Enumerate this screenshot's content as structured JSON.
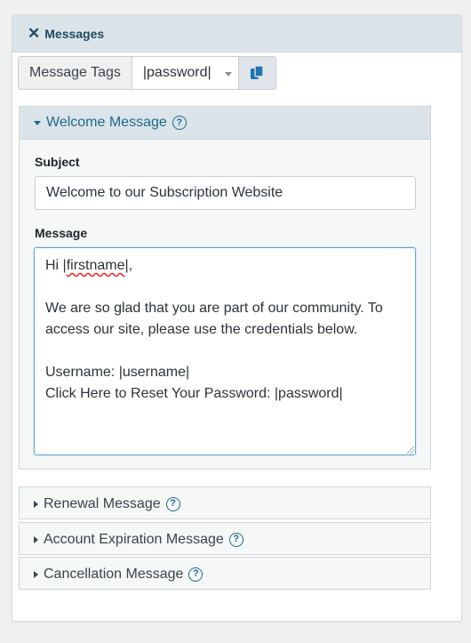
{
  "panel": {
    "close_glyph": "✕",
    "title": "Messages"
  },
  "tags": {
    "label": "Message Tags",
    "selected": "|password|",
    "copy_icon": "copy-icon"
  },
  "welcome": {
    "title": "Welcome Message",
    "help": "?",
    "subject_label": "Subject",
    "subject_value": "Welcome to our Subscription Website",
    "message_label": "Message",
    "message_line1_prefix": "Hi |",
    "message_line1_word": "firstname",
    "message_line1_suffix": "|,",
    "message_body": "We are so glad that you are part of our community. To access our site, please use the credentials below.",
    "message_username": "Username: |username|",
    "message_reset": "Click Here to Reset Your Password: |password|"
  },
  "collapsed_sections": [
    {
      "title": "Renewal Message",
      "help": "?"
    },
    {
      "title": "Account Expiration Message",
      "help": "?"
    },
    {
      "title": "Cancellation Message",
      "help": "?"
    }
  ],
  "colors": {
    "header_bg": "#dbe4e9",
    "accent": "#1d6a88",
    "copy_icon": "#2271b1"
  }
}
